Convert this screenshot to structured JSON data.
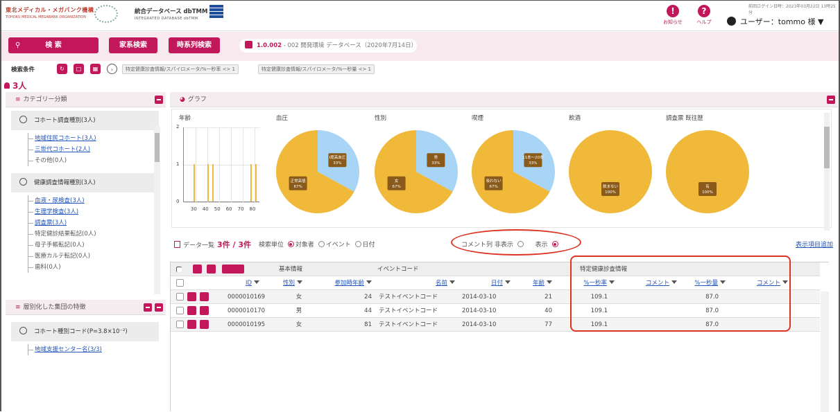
{
  "header": {
    "org_name": "東北メディカル・メガバンク機構",
    "org_name_en": "TOHOKU MEDICAL MEGABANK ORGANIZATION",
    "db_title": "統合データベース dbTMM",
    "db_subtitle": "INTEGRATED DATABASE dbTMM",
    "notice_label": "お知らせ",
    "help_label": "ヘルプ",
    "login_time": "前回ログイン日時：2023年03月22日 13時25分",
    "user_label": "ユーザー：tommo 様 ▼"
  },
  "toolbar": {
    "search_label": "検 索",
    "family_search_label": "家系検索",
    "timeseries_search_label": "時系列検索",
    "version_label": "1.0.002",
    "version_text": "- 002 開発環境 データベース（2020年7月14日）"
  },
  "conditions": {
    "label": "検索条件",
    "chips": [
      "特定健康診査情報/スパイロメータ/%一秒率 <> 1",
      "特定健康診査情報/スパイロメータ/%一秒量 <> 1"
    ]
  },
  "result_count": "3人",
  "category": {
    "title": "カテゴリー分類",
    "groups": [
      {
        "name": "コホート調査種別(3人)",
        "items": [
          {
            "label": "地域住民コホート(3人)",
            "link": true
          },
          {
            "label": "三世代コホート(2人)",
            "link": true
          },
          {
            "label": "その他(0人)",
            "link": false
          }
        ]
      },
      {
        "name": "健康調査情報種別(3人)",
        "items": [
          {
            "label": "血液・尿検査(3人)",
            "link": true
          },
          {
            "label": "生理学検査(3人)",
            "link": true
          },
          {
            "label": "調査票(3人)",
            "link": true
          },
          {
            "label": "特定健診結果転記(0人)",
            "link": false
          },
          {
            "label": "母子手帳転記(0人)",
            "link": false
          },
          {
            "label": "医療カルテ転記(0人)",
            "link": false
          },
          {
            "label": "歯科(0人)",
            "link": false
          }
        ]
      }
    ]
  },
  "features": {
    "title": "層別化した集団の特徴",
    "group": "コホート種別コード(P=3.8×10⁻²)",
    "items": [
      "地域支援センター名(3/3)"
    ]
  },
  "graph": {
    "title": "グラフ",
    "charts": [
      {
        "title": "年齢"
      },
      {
        "title": "血圧",
        "slices": [
          {
            "label": "I度高血圧",
            "pct": "33%",
            "value": 33
          },
          {
            "label": "正常高値",
            "pct": "67%",
            "value": 67
          }
        ]
      },
      {
        "title": "性別",
        "slices": [
          {
            "label": "男",
            "pct": "33%",
            "value": 33
          },
          {
            "label": "女",
            "pct": "67%",
            "value": 67
          }
        ]
      },
      {
        "title": "喫煙",
        "slices": [
          {
            "label": "11本〜20本",
            "pct": "33%",
            "value": 33
          },
          {
            "label": "吸わない",
            "pct": "67%",
            "value": 67
          }
        ]
      },
      {
        "title": "飲酒",
        "slices": [
          {
            "label": "飲まない",
            "pct": "100%",
            "value": 100
          }
        ]
      },
      {
        "title": "調査票 既往歴",
        "slices": [
          {
            "label": "有",
            "pct": "100%",
            "value": 100
          }
        ]
      }
    ],
    "colors": {
      "blue": "#a8d4f5",
      "yellow": "#f0b93a",
      "label_bg": "#8a5a1a"
    }
  },
  "chart_data": {
    "type": "bar",
    "title": "年齢",
    "x": [
      28,
      40,
      44,
      77,
      81
    ],
    "values": [
      1,
      1,
      1,
      1,
      1
    ],
    "xticks": [
      30,
      40,
      50,
      60,
      70,
      80
    ],
    "yticks": [
      0,
      1,
      2
    ],
    "ylim": [
      0,
      2
    ]
  },
  "datalist": {
    "title": "データ一覧",
    "count": "3件 / 3件",
    "unit_label": "検索単位",
    "unit_options": [
      "対象者",
      "イベント",
      "日付"
    ],
    "comment_label": "コメント列 非表示",
    "show_label": "表示",
    "add_item_link": "表示項目追加",
    "group_basic": "基本情報",
    "group_event": "イベントコード",
    "group_health": "特定健康診査情報",
    "columns": [
      "ID",
      "性別",
      "参加時年齢",
      "名前",
      "日付",
      "年齢",
      "%一秒率",
      "コメント",
      "%一秒量",
      "コメント"
    ],
    "rows": [
      {
        "id": "0000010169",
        "sex": "女",
        "age": "24",
        "name": "テストイベントコード",
        "date": "2014-03-10",
        "eage": "21",
        "fev1p": "109.1",
        "fev1v": "87.0"
      },
      {
        "id": "0000010170",
        "sex": "男",
        "age": "44",
        "name": "テストイベントコード",
        "date": "2014-03-10",
        "eage": "40",
        "fev1p": "109.1",
        "fev1v": "87.0"
      },
      {
        "id": "0000010195",
        "sex": "女",
        "age": "81",
        "name": "テストイベントコード",
        "date": "2014-03-10",
        "eage": "77",
        "fev1p": "109.1",
        "fev1v": "87.0"
      }
    ]
  }
}
